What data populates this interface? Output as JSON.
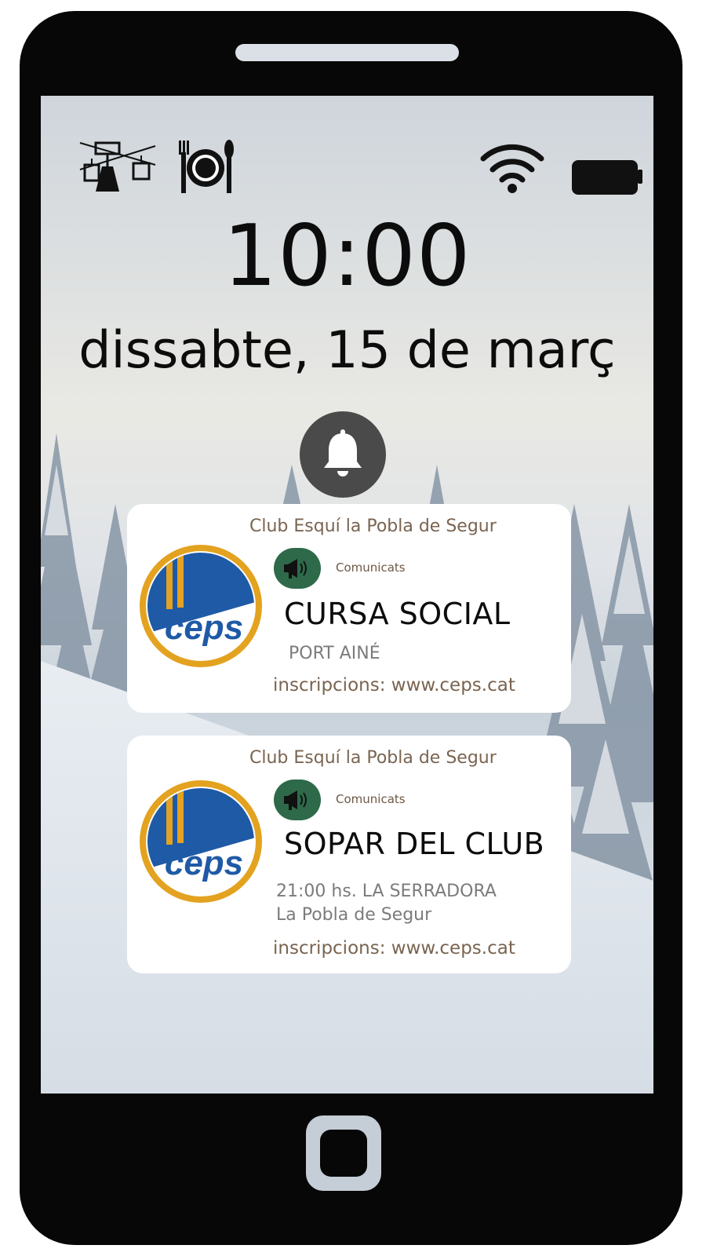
{
  "lockscreen": {
    "time": "10:00",
    "date": "dissabte, 15 de març"
  },
  "status_icons": [
    "ski-lift-icon",
    "dining-plate-icon",
    "wifi-icon",
    "battery-icon"
  ],
  "colors": {
    "phone_frame": "#070707",
    "card_text_brown": "#7a6450",
    "category_badge": "#2e6a4a",
    "bell_background": "#4a4a4a",
    "logo_blue": "#1f5aa6",
    "logo_gold": "#e3a21f"
  },
  "notifications": [
    {
      "club": "Club Esquí la Pobla de Segur",
      "category": "Comunicats",
      "logo_text": "ceps",
      "title": "CURSA SOCIAL",
      "details": [
        "PORT AINÉ"
      ],
      "link": "inscripcions: www.ceps.cat"
    },
    {
      "club": "Club Esquí la Pobla de Segur",
      "category": "Comunicats",
      "logo_text": "ceps",
      "title": "SOPAR DEL CLUB",
      "details": [
        "21:00 hs. LA SERRADORA",
        "La Pobla de Segur"
      ],
      "link": "inscripcions: www.ceps.cat"
    }
  ]
}
